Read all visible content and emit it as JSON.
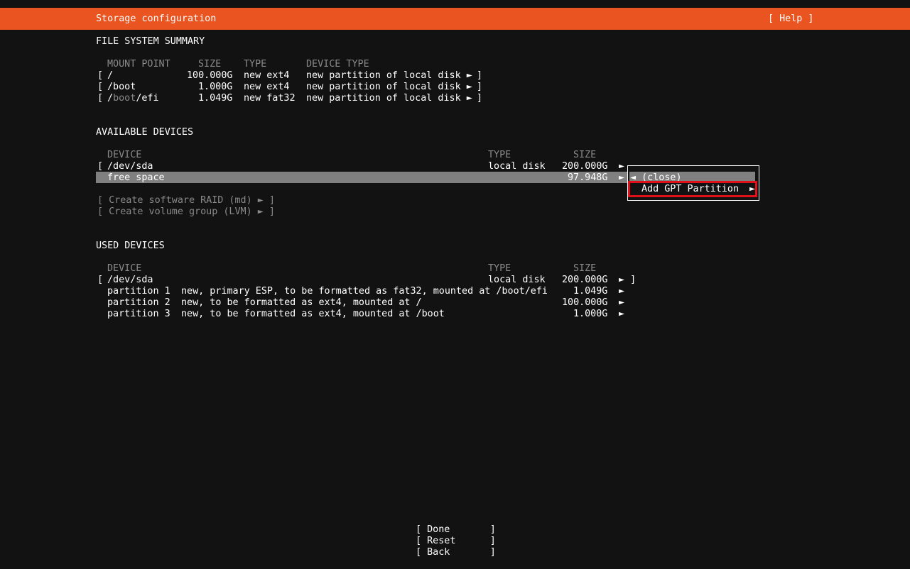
{
  "header": {
    "title": "Storage configuration",
    "help": "[ Help ]"
  },
  "fs_summary": {
    "title": "FILE SYSTEM SUMMARY",
    "columns": [
      "MOUNT POINT",
      "SIZE",
      "TYPE",
      "DEVICE TYPE"
    ],
    "rows": [
      {
        "bracket": "[",
        "mount_pre": "/",
        "mount_dim": "",
        "mount_post": "",
        "size": "100.000G",
        "type": "new ext4",
        "device_type": "new partition of local disk ►",
        "end": "]"
      },
      {
        "bracket": "[",
        "mount_pre": "/boot",
        "mount_dim": "",
        "mount_post": "",
        "size": "1.000G",
        "type": "new ext4",
        "device_type": "new partition of local disk ►",
        "end": "]"
      },
      {
        "bracket": "[",
        "mount_pre": "/",
        "mount_dim": "boot",
        "mount_post": "/efi",
        "size": "1.049G",
        "type": "new fat32",
        "device_type": "new partition of local disk ►",
        "end": "]"
      }
    ]
  },
  "available": {
    "title": "AVAILABLE DEVICES",
    "columns": [
      "DEVICE",
      "TYPE",
      "SIZE"
    ],
    "disk": {
      "bracket": "[",
      "name": "/dev/sda",
      "type": "local disk",
      "size": "200.000G",
      "arrow": "►"
    },
    "free": {
      "name": "free space",
      "size": "97.948G",
      "arrow": "►"
    },
    "actions": [
      "[ Create software RAID (md) ► ]",
      "[ Create volume group (LVM) ► ]"
    ]
  },
  "popup": {
    "close": "◄ (close)",
    "add_gpt": "Add GPT Partition",
    "add_gpt_arrow": "►"
  },
  "used": {
    "title": "USED DEVICES",
    "columns": [
      "DEVICE",
      "TYPE",
      "SIZE"
    ],
    "disk": {
      "bracket": "[",
      "name": "/dev/sda",
      "type": "local disk",
      "size": "200.000G",
      "arrow": "► ]"
    },
    "partitions": [
      {
        "name": "partition 1",
        "desc": "new, primary ESP, to be formatted as fat32, mounted at /boot/efi",
        "size": "1.049G",
        "arrow": "►"
      },
      {
        "name": "partition 2",
        "desc": "new, to be formatted as ext4, mounted at /",
        "size": "100.000G",
        "arrow": "►"
      },
      {
        "name": "partition 3",
        "desc": "new, to be formatted as ext4, mounted at /boot",
        "size": "1.000G",
        "arrow": "►"
      }
    ]
  },
  "footer": {
    "buttons": [
      "[ Done       ]",
      "[ Reset      ]",
      "[ Back       ]"
    ]
  },
  "colors": {
    "accent": "#e95420",
    "background": "#121212",
    "selection": "#808080",
    "highlight": "#e0101a"
  }
}
